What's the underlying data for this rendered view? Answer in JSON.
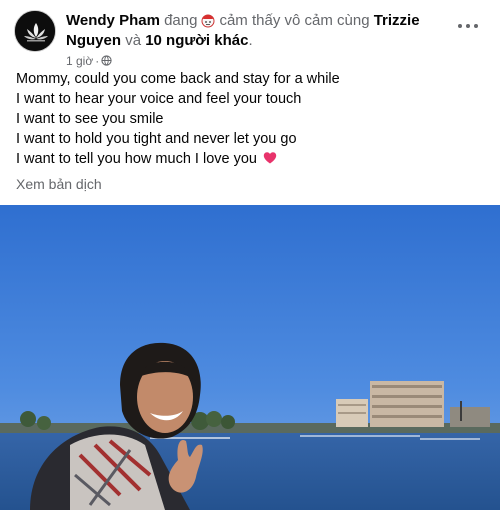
{
  "post": {
    "author": "Wendy Pham",
    "feeling_prefix": "đang",
    "feeling": "cảm thấy vô cảm cùng",
    "tagged": "Trizzie Nguyen",
    "and_word": "và",
    "others": "10 người khác",
    "period": ".",
    "time": "1 giờ",
    "privacy_icon": "globe-icon",
    "more_icon": "more-horizontal-icon",
    "lines": [
      "Mommy, could you come back and stay for a while",
      "I want to hear your voice and feel your touch",
      "I want to see you smile",
      "I want to hold you tight and never let you go",
      "I want to tell you how much I love you"
    ],
    "heart_icon": "heart-icon",
    "translate_label": "Xem bản dịch"
  },
  "colors": {
    "text": "#050505",
    "muted": "#65676b",
    "sky": "#3d7fd8",
    "water": "#2a5c9a",
    "heart": "#e8336b"
  }
}
